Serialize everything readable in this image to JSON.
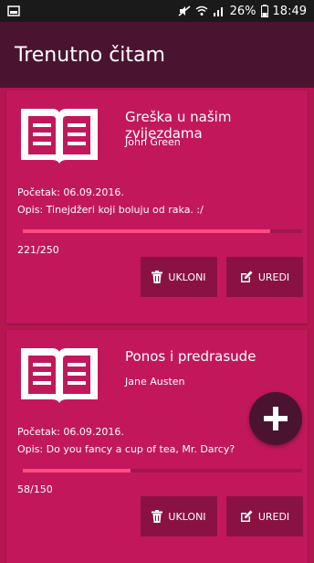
{
  "status_bar": {
    "battery": "26%",
    "time": "18:49"
  },
  "app_bar": {
    "title": "Trenutno čitam"
  },
  "books": [
    {
      "title": "Greška u našim zvijezdama",
      "author": "John Green",
      "start": "Početak: 06.09.2016.",
      "description": "Opis: Tinejdžeri koji boluju od raka. :/",
      "progress_text": "221/250",
      "progress": 0.884,
      "remove_label": "UKLONI",
      "edit_label": "UREDI"
    },
    {
      "title": "Ponos i predrasude",
      "author": "Jane Austen",
      "start": "Početak: 06.09.2016.",
      "description": "Opis: Do you fancy a cup of tea, Mr. Darcy?",
      "progress_text": "58/150",
      "progress": 0.387,
      "remove_label": "UKLONI",
      "edit_label": "UREDI"
    }
  ],
  "fab": {
    "icon": "plus-icon"
  }
}
